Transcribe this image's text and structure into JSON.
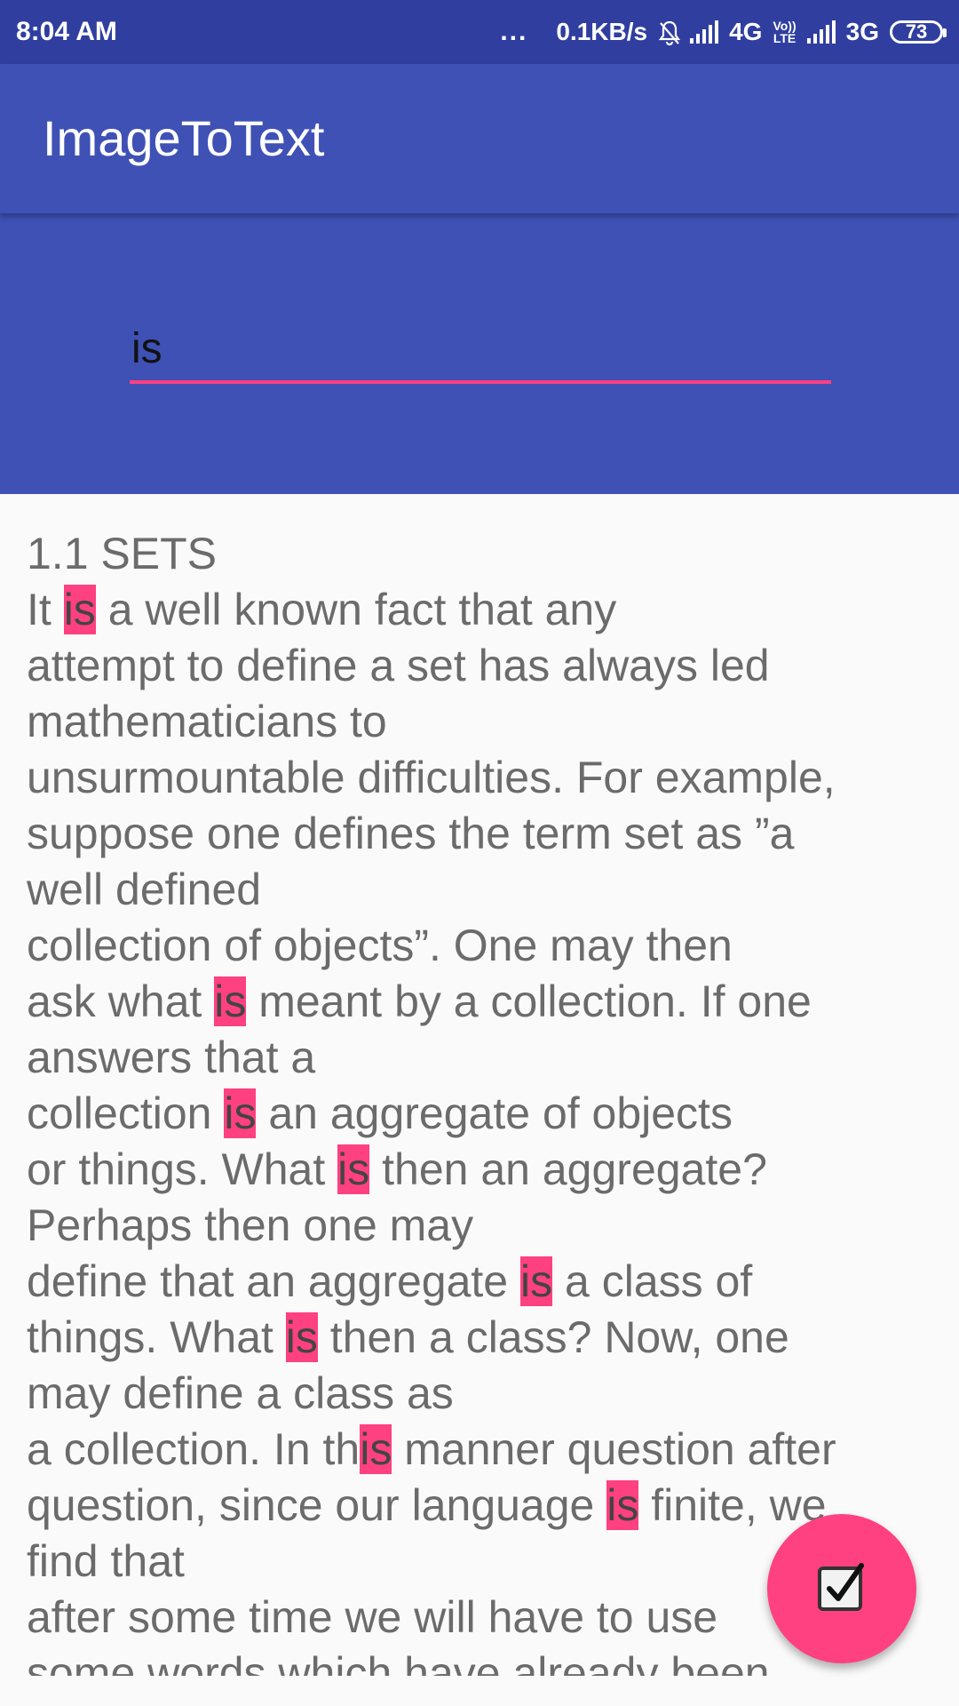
{
  "status_bar": {
    "time": "8:04 AM",
    "more": "...",
    "speed": "0.1KB/s",
    "network1": "4G",
    "lte_top": "Vo))",
    "lte_bottom": "LTE",
    "network2": "3G",
    "battery": "73",
    "icons": [
      "notification-off-icon",
      "signal-icon",
      "battery-icon"
    ]
  },
  "app_bar": {
    "title": "ImageToText"
  },
  "search": {
    "value": "is",
    "placeholder": ""
  },
  "highlight_term": "is",
  "result_lines": [
    "1.1 SETS",
    "It is a well known fact that any",
    "attempt to define a set has always led",
    "mathematicians to",
    "unsurmountable difficulties. For example,",
    "suppose one defines the term set as ”a",
    "well defined",
    "collection of objects”. One may then",
    "ask what is meant by a collection. If one",
    "answers that a",
    "collection is an aggregate of objects",
    "or things. What is then an aggregate?",
    "Perhaps then one may",
    "define that an aggregate is a class of",
    "things. What is then a class? Now, one",
    "may define a class as",
    "a collection. In this manner question after",
    "question, since our language is finite, we",
    "find that",
    "after some time we will have to use",
    "some words which have already been"
  ],
  "fab": {
    "icon": "checkbox-checked-icon"
  },
  "colors": {
    "status_bar": "#303f9f",
    "primary": "#3f51b5",
    "accent": "#ff4081",
    "text": "#6b6b6b",
    "background": "#fafafa"
  }
}
